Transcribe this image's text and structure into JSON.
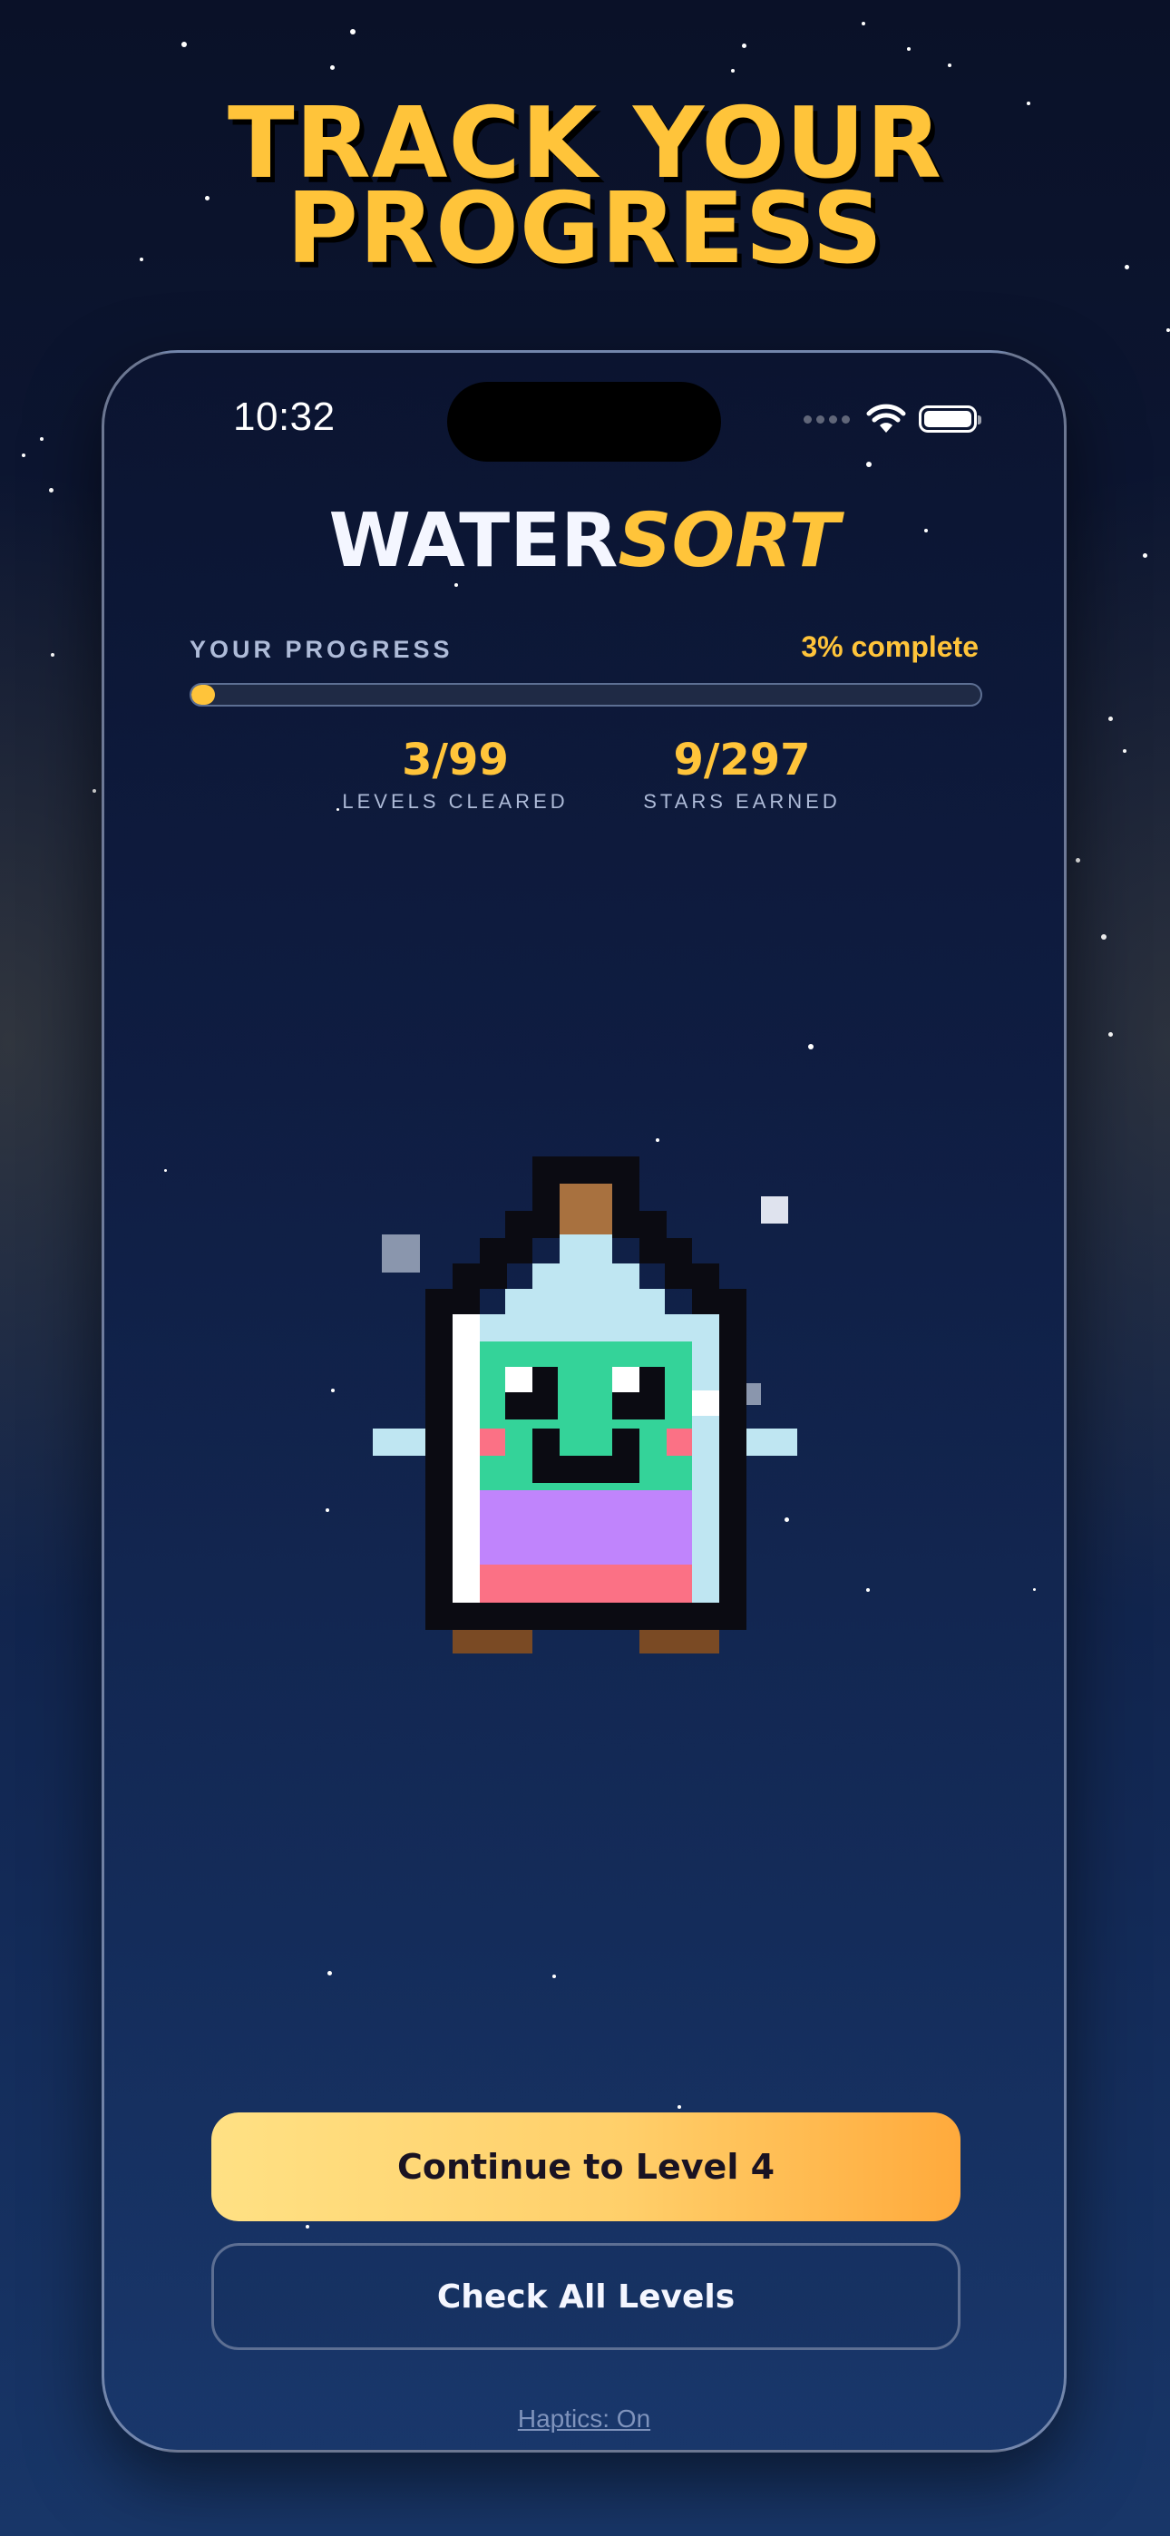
{
  "promo": {
    "title_line1": "TRACK YOUR",
    "title_line2": "PROGRESS"
  },
  "status_bar": {
    "time": "10:32"
  },
  "logo": {
    "part1": "WATER",
    "part2": "SORT"
  },
  "progress": {
    "label": "YOUR PROGRESS",
    "percent_text": "3% complete",
    "fraction": 0.03
  },
  "stats": [
    {
      "value": "3/99",
      "caption": "LEVELS CLEARED"
    },
    {
      "value": "9/297",
      "caption": "STARS EARNED"
    }
  ],
  "actions": {
    "continue_label": "Continue to Level 4",
    "check_levels_label": "Check All Levels",
    "haptics_label": "Haptics: On"
  },
  "colors": {
    "accent": "#ffc43a",
    "background": "#0e1a3a",
    "mascot_face": "#34d399",
    "mascot_liquid_purple": "#c084fc",
    "mascot_liquid_pink": "#fb7185"
  },
  "icons": [
    "wifi-icon",
    "battery-icon",
    "signal-icon",
    "mascot-bottle-icon"
  ]
}
